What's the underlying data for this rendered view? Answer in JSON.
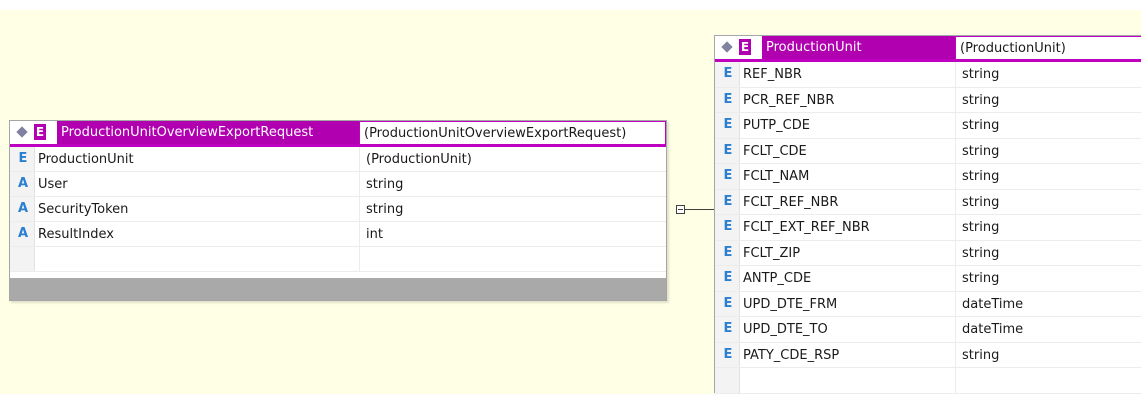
{
  "tables": {
    "request": {
      "header_badge": "E",
      "name": "ProductionUnitOverviewExportRequest",
      "type": "(ProductionUnitOverviewExportRequest)",
      "rows": [
        {
          "badge": "E",
          "name": "ProductionUnit",
          "type": "(ProductionUnit)"
        },
        {
          "badge": "A",
          "name": "User",
          "type": "string"
        },
        {
          "badge": "A",
          "name": "SecurityToken",
          "type": "string"
        },
        {
          "badge": "A",
          "name": "ResultIndex",
          "type": "int"
        }
      ]
    },
    "production_unit": {
      "header_badge": "E",
      "name": "ProductionUnit",
      "type": "(ProductionUnit)",
      "rows": [
        {
          "badge": "E",
          "name": "REF_NBR",
          "type": "string"
        },
        {
          "badge": "E",
          "name": "PCR_REF_NBR",
          "type": "string"
        },
        {
          "badge": "E",
          "name": "PUTP_CDE",
          "type": "string"
        },
        {
          "badge": "E",
          "name": "FCLT_CDE",
          "type": "string"
        },
        {
          "badge": "E",
          "name": "FCLT_NAM",
          "type": "string"
        },
        {
          "badge": "E",
          "name": "FCLT_REF_NBR",
          "type": "string"
        },
        {
          "badge": "E",
          "name": "FCLT_EXT_REF_NBR",
          "type": "string"
        },
        {
          "badge": "E",
          "name": "FCLT_ZIP",
          "type": "string"
        },
        {
          "badge": "E",
          "name": "ANTP_CDE",
          "type": "string"
        },
        {
          "badge": "E",
          "name": "UPD_DTE_FRM",
          "type": "dateTime"
        },
        {
          "badge": "E",
          "name": "UPD_DTE_TO",
          "type": "dateTime"
        },
        {
          "badge": "E",
          "name": "PATY_CDE_RSP",
          "type": "string"
        }
      ]
    }
  },
  "colors": {
    "canvas": "#ffffe6",
    "header_accent": "#b000b0",
    "badge": "#2a7fd0"
  }
}
